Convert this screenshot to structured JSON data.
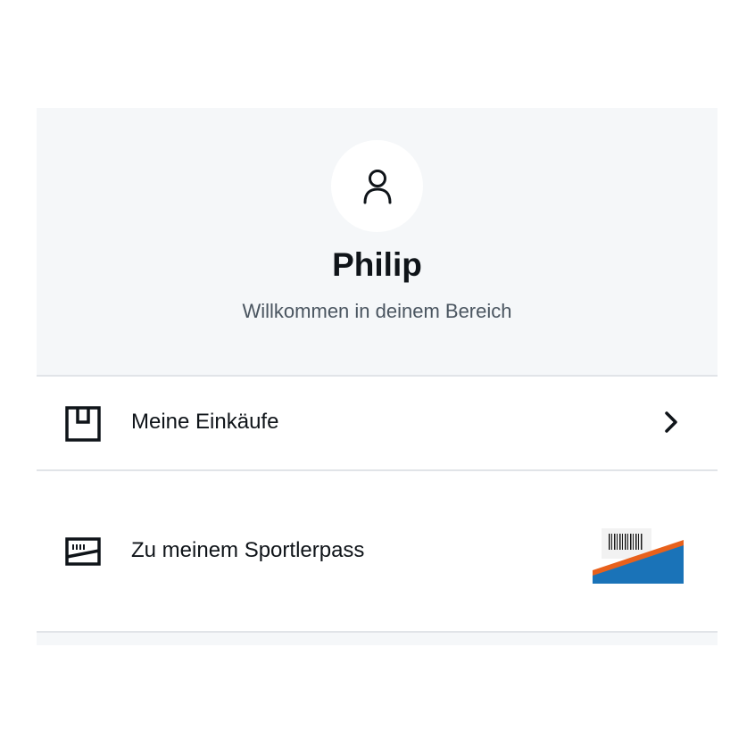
{
  "profile": {
    "name": "Philip",
    "welcome_text": "Willkommen in deinem Bereich",
    "avatar_icon": "user-icon"
  },
  "menu": {
    "items": [
      {
        "label": "Meine Einkäufe",
        "icon": "box-icon",
        "trailing": "chevron-right-icon"
      },
      {
        "label": "Zu meinem Sportlerpass",
        "icon": "card-icon",
        "trailing": "sportlerpass-card-image"
      }
    ]
  },
  "colors": {
    "header_bg": "#f5f7f9",
    "divider": "#e1e4e8",
    "text_primary": "#0f1419",
    "text_secondary": "#4a5560",
    "pass_blue": "#1a73b8",
    "pass_orange": "#e8611c"
  }
}
